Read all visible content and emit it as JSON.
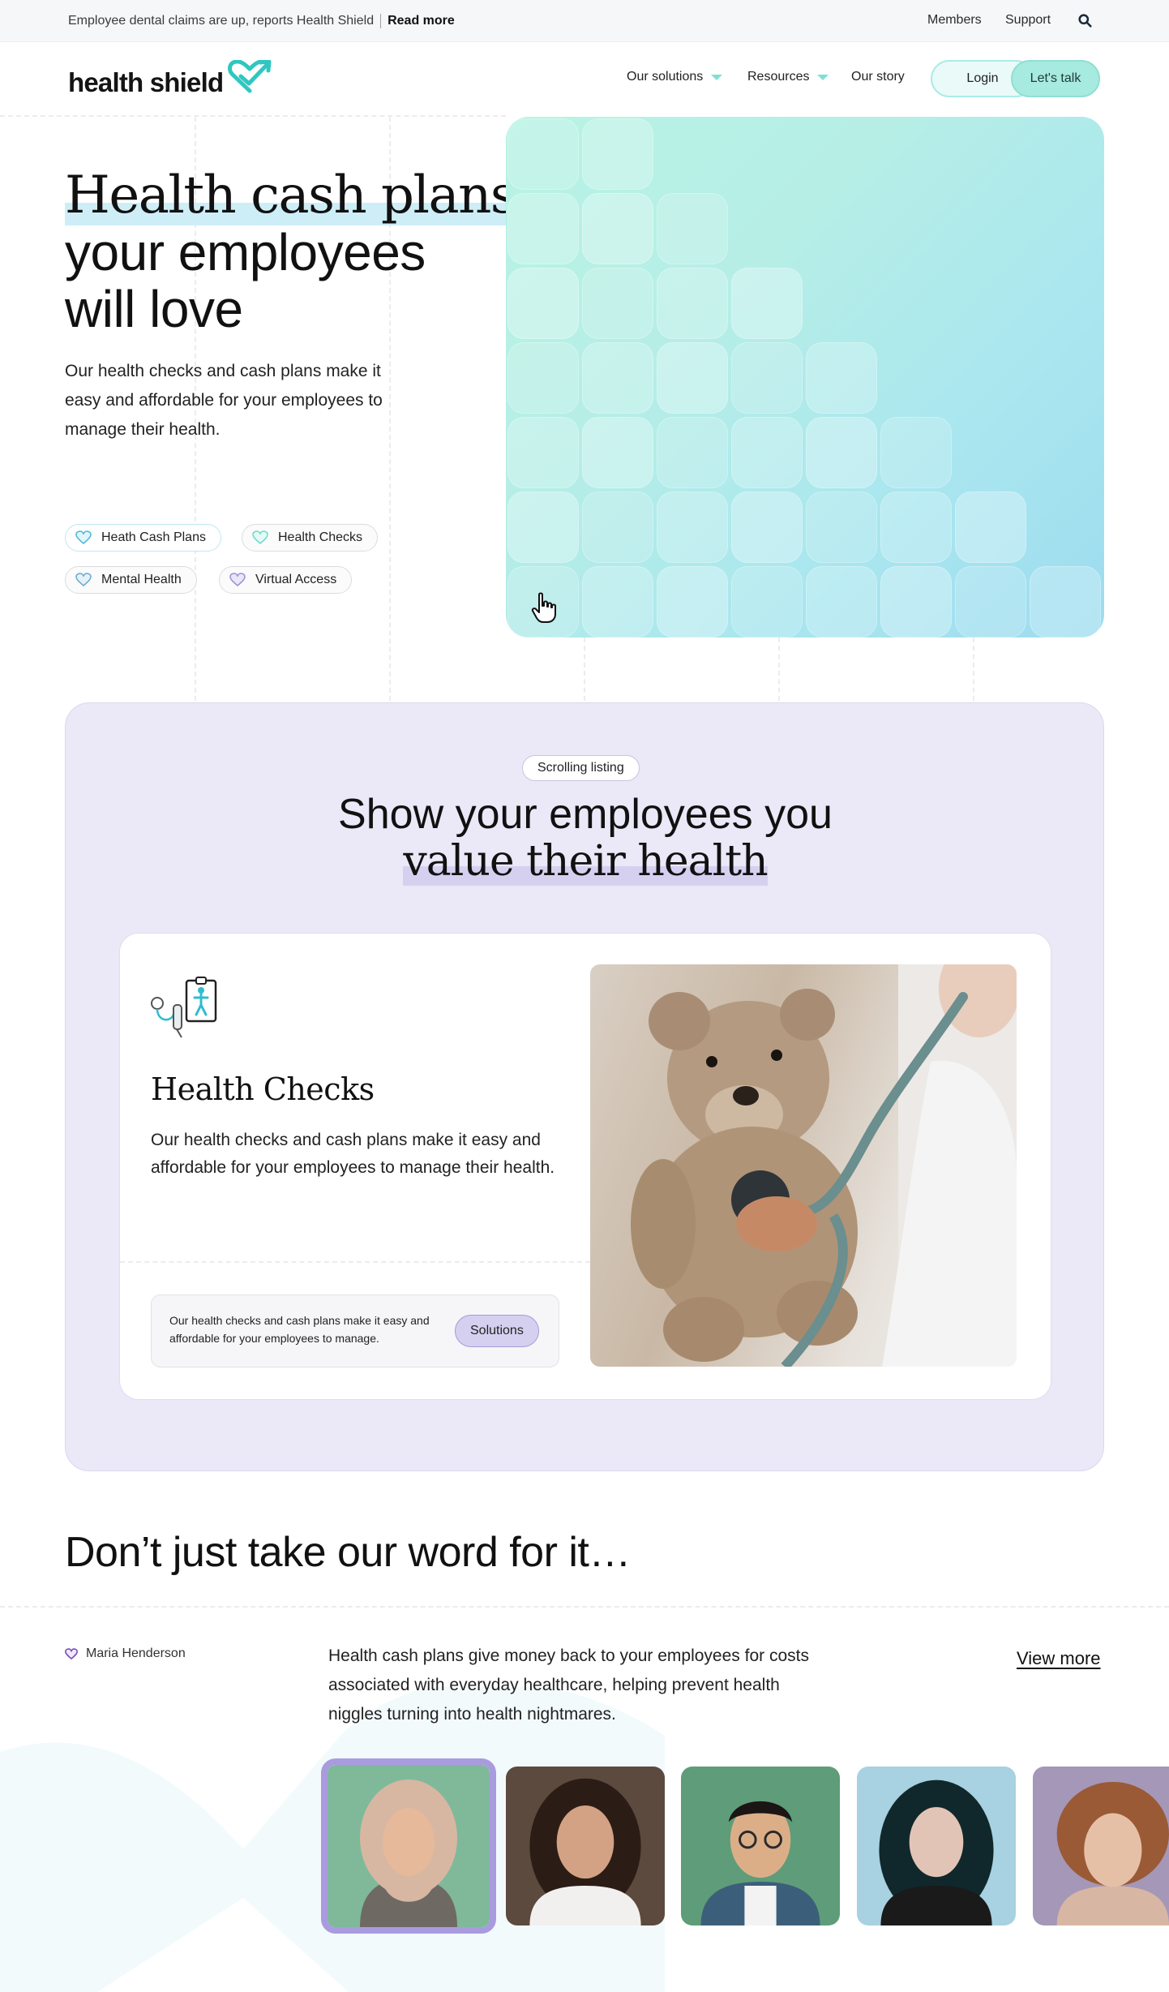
{
  "topbar": {
    "announcement": "Employee dental claims are up, reports Health Shield",
    "read_more": "Read more",
    "members": "Members",
    "support": "Support"
  },
  "header": {
    "logo_text": "health shield",
    "nav": [
      "Our solutions",
      "Resources",
      "Our story"
    ],
    "login": "Login",
    "lets_talk": "Let's talk"
  },
  "hero": {
    "title_highlight": "Health cash plans",
    "title_line2": "your employees",
    "title_line3": "will love",
    "subtitle": "Our health checks and cash plans make it easy and affordable for your employees to manage their health.",
    "chips": [
      "Heath Cash Plans",
      "Health Checks",
      "Mental Health",
      "Virtual Access"
    ]
  },
  "listing": {
    "tag": "Scrolling listing",
    "title_line1": "Show your employees you",
    "title_line2": "value their health",
    "card": {
      "title": "Health Checks",
      "text": "Our health checks and cash plans make it easy and affordable for your employees to manage their health.",
      "note": "Our health checks and cash plans make it easy and affordable for your employees to manage.",
      "button": "Solutions"
    }
  },
  "testimonials": {
    "title": "Don’t just take our word for it…",
    "name": "Maria Henderson",
    "quote": "Health cash plans give money back to your employees for costs associated with everyday healthcare, helping prevent health niggles turning into health nightmares.",
    "view_more": "View more"
  },
  "colors": {
    "brand_teal": "#2fc7c0",
    "listing_bg": "#ebe8f7",
    "highlight_lavender": "#d6d0f0",
    "highlight_sky": "#cdeef7"
  },
  "icons": [
    "search-icon",
    "chevron-down-icon",
    "heart-icon",
    "hand-pointer-icon"
  ]
}
